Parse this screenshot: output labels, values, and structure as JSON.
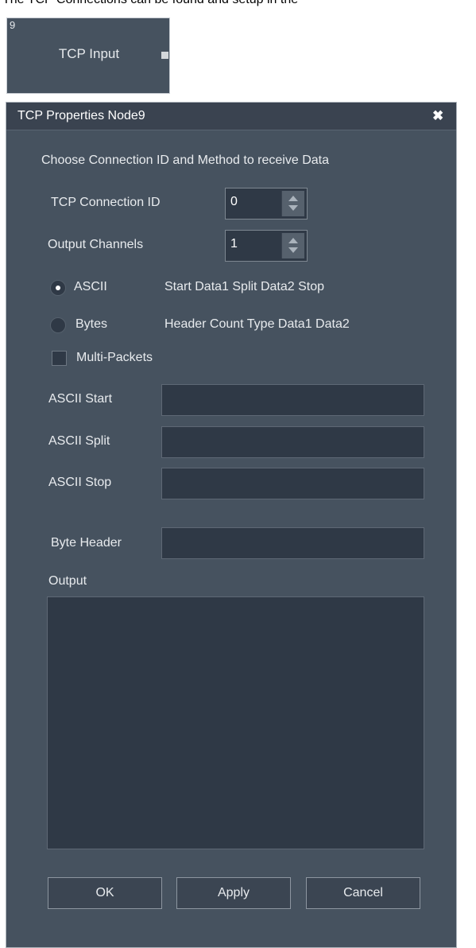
{
  "page": {
    "caption": "The TCP Connections can be found and setup in the"
  },
  "node": {
    "id": "9",
    "title": "TCP Input"
  },
  "dialog": {
    "title": "TCP Properties Node9",
    "close_glyph": "✖",
    "heading": "Choose Connection ID and Method to receive Data",
    "connection_id": {
      "label": "TCP Connection ID",
      "value": "0"
    },
    "output_channels": {
      "label": "Output Channels",
      "value": "1"
    },
    "methods": [
      {
        "label": "ASCII",
        "format": "Start Data1 Split Data2 Stop",
        "selected": true
      },
      {
        "label": "Bytes",
        "format": "Header Count Type Data1 Data2",
        "selected": false
      }
    ],
    "multi_packets": {
      "label": "Multi-Packets",
      "checked": false
    },
    "ascii_start": {
      "label": "ASCII Start",
      "value": ""
    },
    "ascii_split": {
      "label": "ASCII Split",
      "value": ""
    },
    "ascii_stop": {
      "label": "ASCII Stop",
      "value": ""
    },
    "byte_header": {
      "label": "Byte Header",
      "value": ""
    },
    "output": {
      "label": "Output",
      "value": ""
    },
    "buttons": {
      "ok": "OK",
      "apply": "Apply",
      "cancel": "Cancel"
    }
  },
  "colors": {
    "panel": "#46525f",
    "field": "#2f3946",
    "titlebar": "#3a4350",
    "text": "#e8ebee"
  }
}
